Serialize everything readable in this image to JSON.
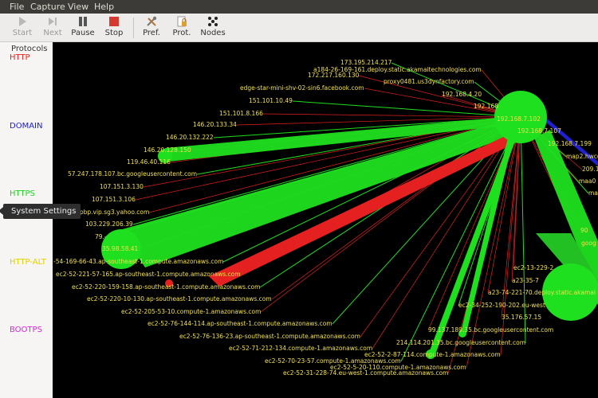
{
  "menu": [
    "File",
    "Capture",
    "View",
    "Help"
  ],
  "toolbar": {
    "start": "Start",
    "next": "Next",
    "pause": "Pause",
    "stop": "Stop",
    "pref": "Pref.",
    "prot": "Prot.",
    "nodes": "Nodes"
  },
  "sidebar": {
    "title": "Protocols",
    "protocols": [
      {
        "label": "HTTP",
        "color": "#e82020"
      },
      {
        "label": "DOMAIN",
        "color": "#2020d0"
      },
      {
        "label": "HTTPS",
        "color": "#20d020"
      },
      {
        "label": "HTTP-ALT",
        "color": "#e0d000"
      },
      {
        "label": "BOOTPS",
        "color": "#e020e0"
      }
    ]
  },
  "tooltip": "System Settings",
  "nodes": [
    "173.195.214.217",
    "a184-26-169-161.deploy.static.akamaitechnologies.com",
    "172.217.160.130",
    "proxy0481.us3dynfactory.com",
    "edge-star-mini-shv-02-sin6.facebook.com",
    "192.168.4.20",
    "151.101.10.49",
    "192.168",
    "151.101.8.166",
    "192.168.7.102",
    "146.20.133.34",
    "192.168.7.107",
    "146.20.132.222",
    "192.168.7.199",
    "146.20.128.150",
    "map2.hwcdn",
    "119.46.40.116",
    "209.1",
    "57.247.178.107.bc.googleusercontent.com",
    "maa0",
    "107.151.3.130",
    "maa",
    "107.151.3.106",
    "-2.pbp.vip.sg3.yahoo.com",
    "103.229.206.39",
    "goog",
    "90",
    "79.",
    "ec2-13-229-2",
    "35.98.58.41",
    "-54-169-66-43.ap-southeast-1.compute.amazonaws.com",
    "ec2-52-221-57-165.ap-southeast-1.compute.amazonaws.com",
    "a23-35-7",
    "ec2-52-220-159-158.ap-southeast-1.compute.amazonaws.com",
    "a23-74-221-70.deploy.static.akamai",
    "ec2-52-220-10-130.ap-southeast-1.compute.amazonaws.com",
    "ec2-34-252-190-202.eu-west",
    "ec2-52-205-53-10.compute-1.amazonaws.com",
    "35.176.57.15",
    "ec2-52-76-144-114.ap-southeast-1.compute.amazonaws.com",
    "99.137.189.35.bc.googleusercontent.com",
    "ec2-52-76-136-23.ap-southeast-1.compute.amazonaws.com",
    "214.114.201.35.bc.googleusercontent.com",
    "ec2-52-71-212-134.compute-1.amazonaws.com",
    "ec2-52-2-87-114.compute-1.amazonaws.com",
    "ec2-52-70-23-57.compute-1.amazonaws.com",
    "ec2-52-5-20-110.compute-1.amazonaws.com",
    "ec2-52-31-228-74.eu-west-1.compute.amazonaws.com"
  ]
}
